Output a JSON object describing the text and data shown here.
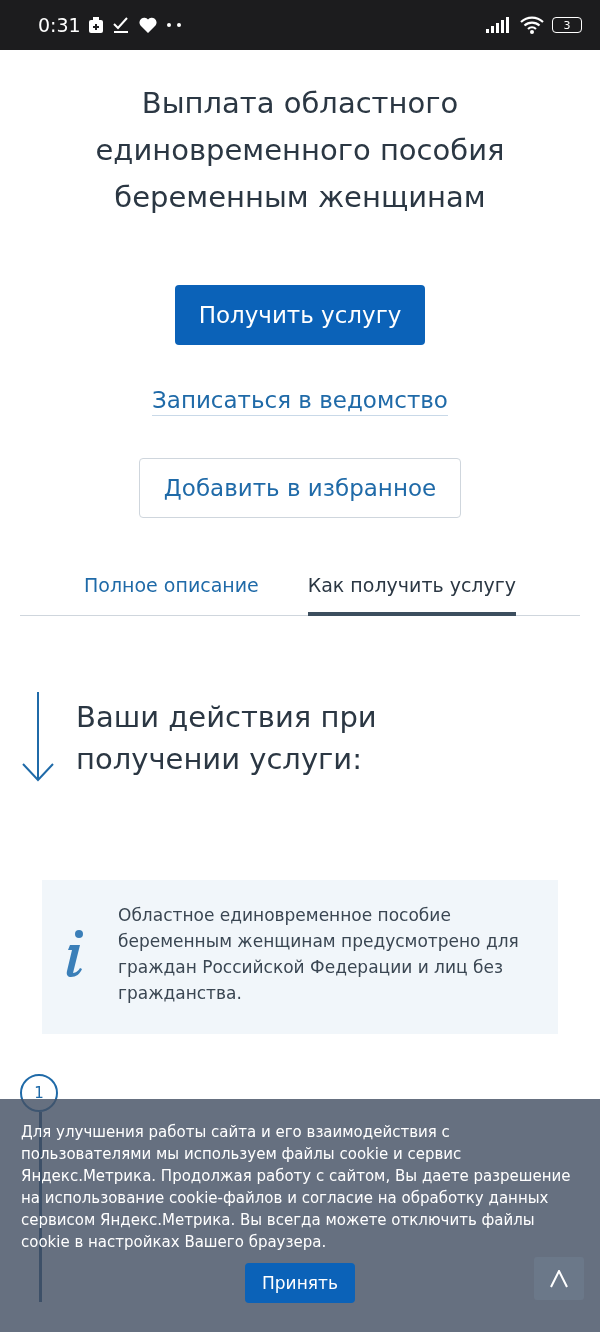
{
  "status_bar": {
    "time": "0:31",
    "battery": "3"
  },
  "title": "Выплата областного единовременного пособия беременным женщинам",
  "primary_button": "Получить услугу",
  "link": "Записаться в ведомство",
  "secondary_button": "Добавить в избранное",
  "tabs": [
    {
      "label": "Полное описание",
      "selected": false
    },
    {
      "label": "Как получить услугу",
      "selected": true
    }
  ],
  "section_heading": "Ваши действия при получении услуги:",
  "info_note": "Областное единовременное пособие беременным женщинам предусмотрено для граждан Российской Федерации и лиц без гражданства.",
  "steps": [
    {
      "number": "1"
    }
  ],
  "cookie_banner": {
    "text": "Для улучшения работы сайта и его взаимодействия с пользователями мы используем файлы cookie и сервис Яндекс.Метрика. Продолжая работу с сайтом, Вы даете разрешение на использование cookie-файлов и согласие на обработку данных сервисом Яндекс.Метрика. Вы всегда можете отключить файлы cookie в настройках Вашего браузера.",
    "accept_button": "Принять"
  }
}
